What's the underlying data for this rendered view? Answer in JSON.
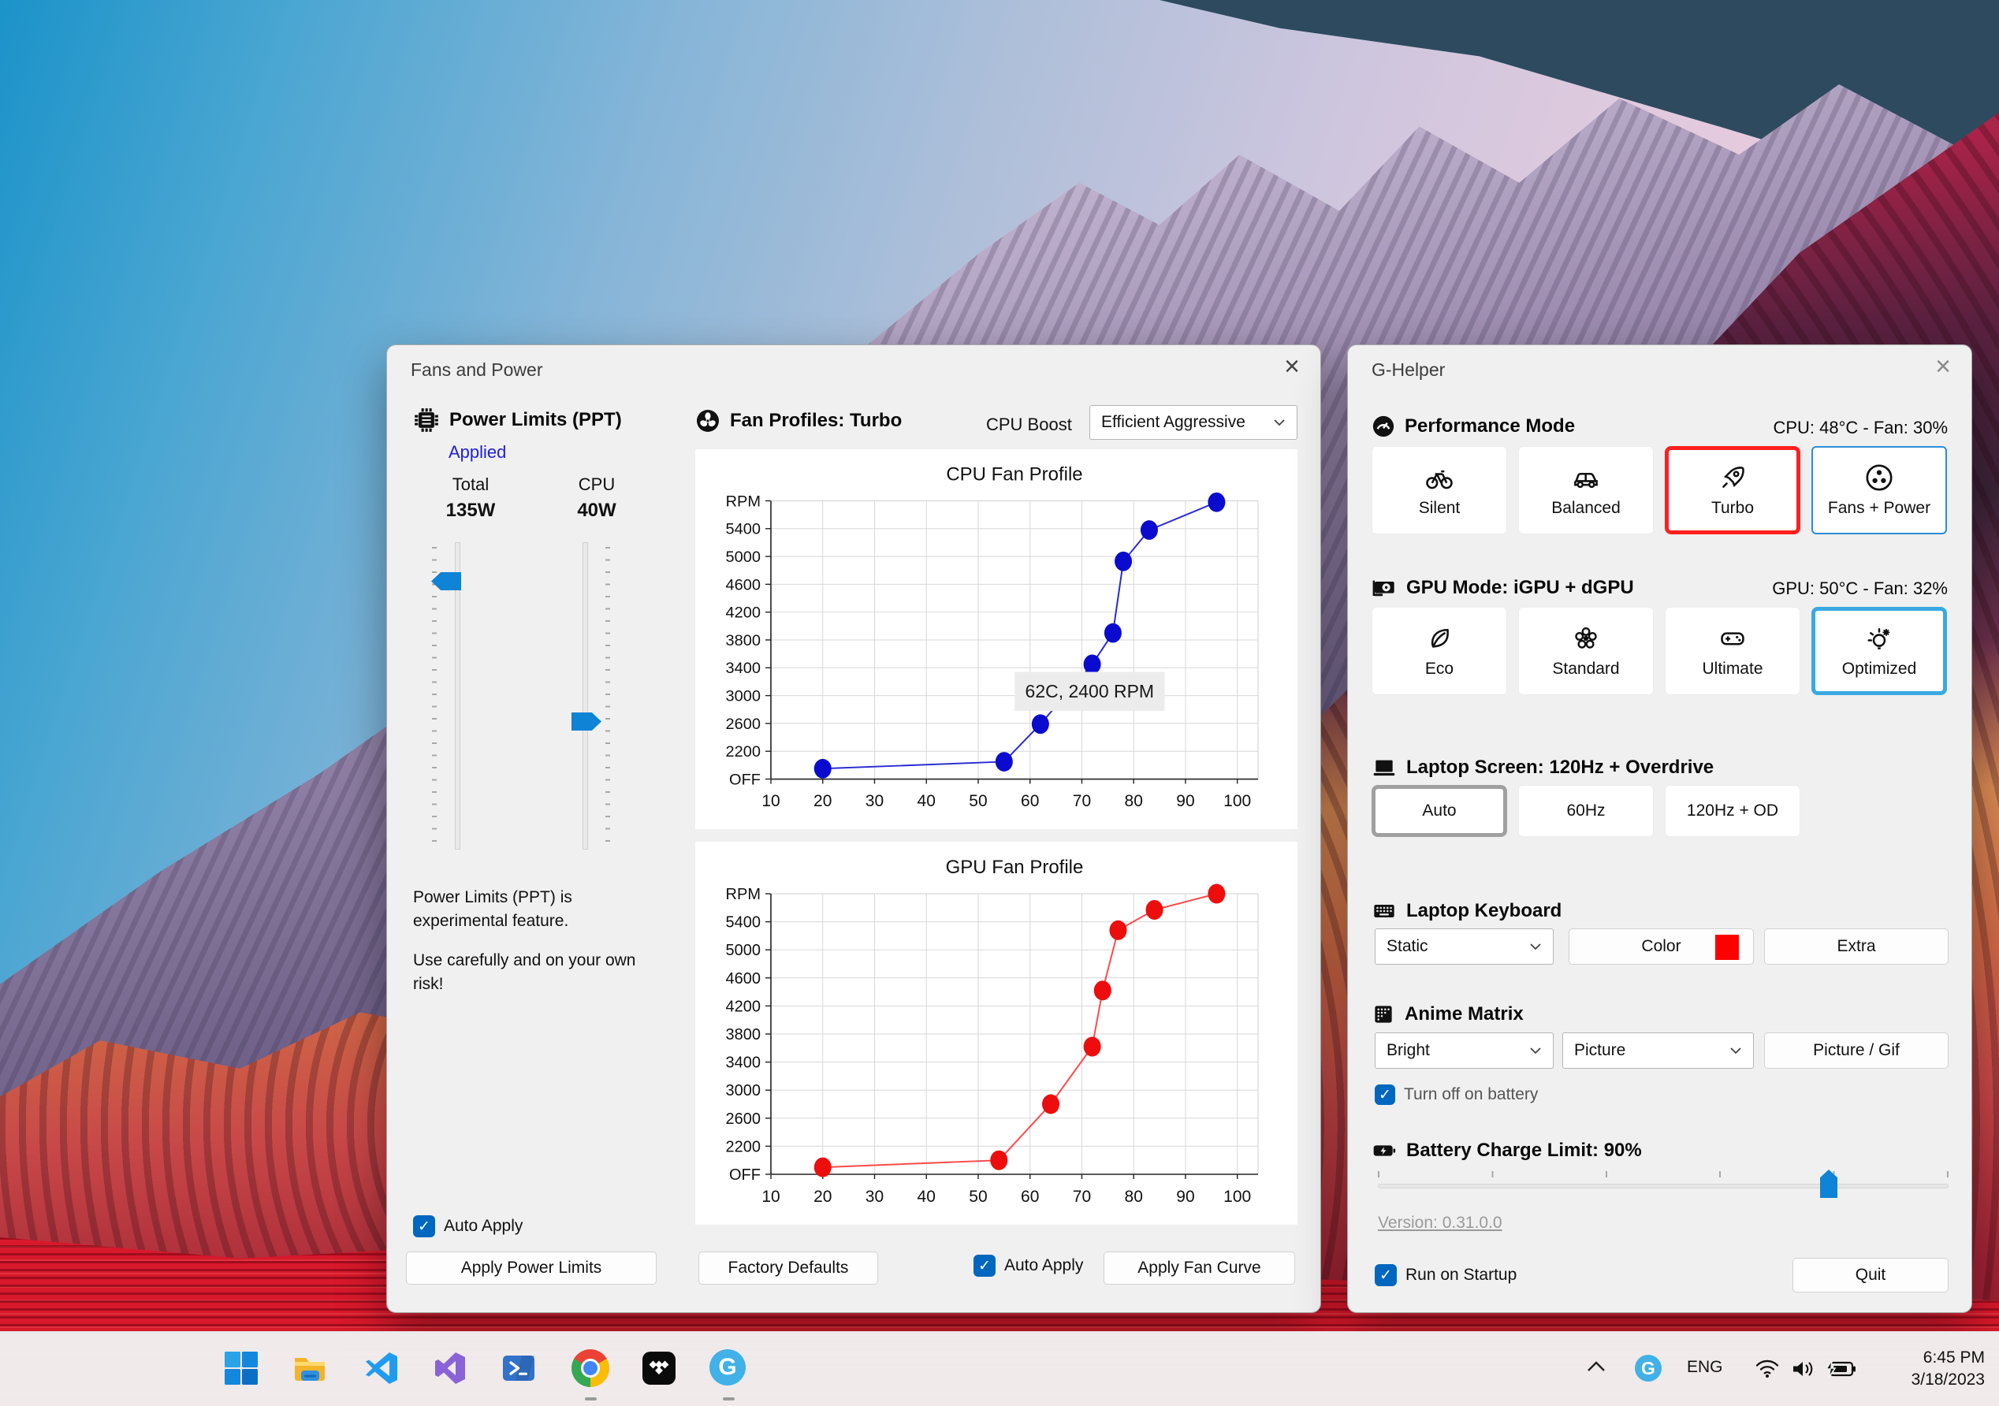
{
  "glyphs": {
    "close": "×",
    "check": "✓"
  },
  "fans_window": {
    "title": "Fans and Power",
    "power": {
      "header": "Power Limits (PPT)",
      "applied": "Applied",
      "total_label": "Total",
      "total_value": "135W",
      "cpu_label": "CPU",
      "cpu_value": "40W",
      "note1": "Power Limits (PPT) is experimental feature.",
      "note2": "Use carefully and on your own risk!",
      "auto_apply": "Auto Apply",
      "apply_button": "Apply Power Limits"
    },
    "profiles": {
      "header": "Fan Profiles: Turbo",
      "cpu_boost_label": "CPU Boost",
      "cpu_boost_value": "Efficient Aggressive",
      "factory_defaults": "Factory Defaults",
      "auto_apply": "Auto Apply",
      "apply_button": "Apply Fan Curve"
    }
  },
  "chart_data": [
    {
      "type": "line",
      "title": "CPU Fan Profile",
      "ylabel": "RPM",
      "xlabel": "",
      "line_color": "#2b2bd0",
      "marker_color": "#0b0bd0",
      "x": [
        20,
        55,
        62,
        72,
        76,
        78,
        83,
        96
      ],
      "y": [
        1950,
        2050,
        2590,
        3450,
        3900,
        4930,
        5380,
        5780
      ],
      "x_ticks": [
        10,
        20,
        30,
        40,
        50,
        60,
        70,
        80,
        90,
        100
      ],
      "y_tick_labels": [
        "OFF",
        "2200",
        "2600",
        "3000",
        "3400",
        "3800",
        "4200",
        "4600",
        "5000",
        "5400",
        "RPM"
      ],
      "y_base": 1800,
      "y_step": 400,
      "xlim": [
        10,
        104
      ],
      "grid": true,
      "legend": "none",
      "tooltip": {
        "text": "62C, 2400 RPM",
        "at": [
          71.5,
          3060
        ]
      }
    },
    {
      "type": "line",
      "title": "GPU Fan Profile",
      "ylabel": "RPM",
      "xlabel": "",
      "line_color": "#ff4a4a",
      "marker_color": "#ee0d0d",
      "x": [
        20,
        54,
        64,
        72,
        74,
        77,
        84,
        96
      ],
      "y": [
        1900,
        2000,
        2800,
        3620,
        4420,
        5280,
        5570,
        5800
      ],
      "x_ticks": [
        10,
        20,
        30,
        40,
        50,
        60,
        70,
        80,
        90,
        100
      ],
      "y_tick_labels": [
        "OFF",
        "2200",
        "2600",
        "3000",
        "3400",
        "3800",
        "4200",
        "4600",
        "5000",
        "5400",
        "RPM"
      ],
      "y_base": 1800,
      "y_step": 400,
      "xlim": [
        10,
        104
      ],
      "grid": true,
      "legend": "none"
    }
  ],
  "ghelper_window": {
    "title": "G-Helper",
    "performance": {
      "header": "Performance Mode",
      "status": "CPU: 48°C -  Fan: 30%",
      "buttons": [
        {
          "label": "Silent"
        },
        {
          "label": "Balanced"
        },
        {
          "label": "Turbo"
        },
        {
          "label": "Fans + Power"
        }
      ]
    },
    "gpu_mode": {
      "header": "GPU Mode: iGPU + dGPU",
      "status": "GPU: 50°C -  Fan: 32%",
      "buttons": [
        {
          "label": "Eco"
        },
        {
          "label": "Standard"
        },
        {
          "label": "Ultimate"
        },
        {
          "label": "Optimized"
        }
      ]
    },
    "screen": {
      "header": "Laptop Screen: 120Hz + Overdrive",
      "buttons": [
        {
          "label": "Auto"
        },
        {
          "label": "60Hz"
        },
        {
          "label": "120Hz + OD"
        }
      ]
    },
    "keyboard": {
      "header": "Laptop Keyboard",
      "mode": "Static",
      "color_button": "Color",
      "swatch_color": "#ff0000",
      "extra_button": "Extra"
    },
    "matrix": {
      "header": "Anime Matrix",
      "brightness": "Bright",
      "mode": "Picture",
      "picture_button": "Picture / Gif",
      "battery_toggle": "Turn off on battery"
    },
    "battery": {
      "header": "Battery Charge Limit: 90%",
      "percent": 90
    },
    "version": "Version: 0.31.0.0",
    "startup": "Run on Startup",
    "quit": "Quit"
  },
  "taskbar": {
    "language": "ENG",
    "time": "6:45 PM",
    "date": "3/18/2023"
  },
  "colors": {
    "accent": "#0067c0",
    "slider_blue": "#0f83d6",
    "selected_red": "#ff1f1f",
    "selected_blue": "#3aa9e2",
    "chart_blue": "#0b0bd0",
    "chart_red": "#ee0d0d",
    "keyboard_swatch": "#ff0000"
  }
}
